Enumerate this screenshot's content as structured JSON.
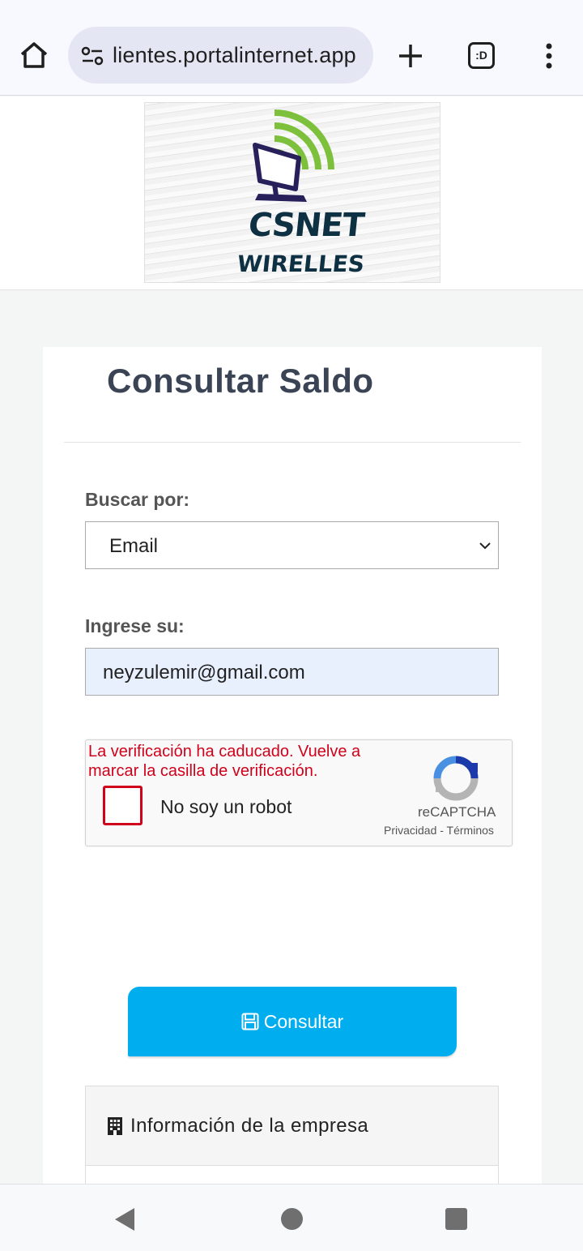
{
  "browser": {
    "url": "lientes.portalinternet.app",
    "tab_count_label": ":D"
  },
  "logo": {
    "line1": "CSNET",
    "line2": "WIRELLES",
    "colors": {
      "text": "#0e3043",
      "signal": "#7dc03c",
      "monitor": "#27205a"
    }
  },
  "card": {
    "title": "Consultar Saldo",
    "search_by_label": "Buscar por:",
    "search_by_value": "Email",
    "enter_label": "Ingrese su:",
    "email_value": "neyzulemir@gmail.com"
  },
  "captcha": {
    "error": "La verificación ha caducado. Vuelve a marcar la casilla de verificación.",
    "checkbox_label": "No soy un robot",
    "brand": "reCAPTCHA",
    "links": "Privacidad - Términos"
  },
  "button": {
    "label": "Consultar",
    "color": "#00aeef"
  },
  "info": {
    "title": "Información de la empresa"
  },
  "icons": [
    "home-icon",
    "site-settings-icon",
    "new-tab-icon",
    "tab-switcher-icon",
    "more-menu-icon",
    "chevron-down-icon",
    "recaptcha-icon",
    "save-icon",
    "building-icon",
    "nav-back-icon",
    "nav-home-icon",
    "nav-recents-icon"
  ]
}
